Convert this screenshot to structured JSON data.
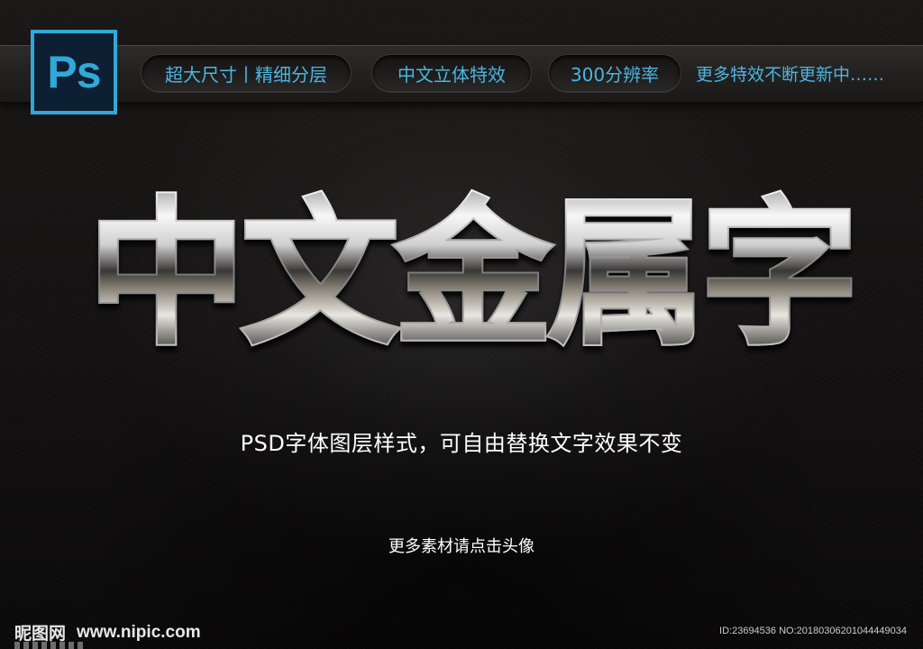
{
  "ps_logo": {
    "text": "Ps",
    "icon": "photoshop-logo-icon",
    "accent_color": "#31a8d8"
  },
  "features": [
    {
      "label": "超大尺寸丨精细分层"
    },
    {
      "label": "中文立体特效"
    },
    {
      "label": "300分辨率"
    }
  ],
  "tagline": "更多特效不断更新中……",
  "headline": "中文金属字",
  "subtitle": "PSD字体图层样式，可自由替换文字效果不变",
  "cta": "更多素材请点击头像",
  "footer": {
    "watermark_cn": "昵图网",
    "watermark_url": "www.nipic.com",
    "image_id": "ID:23694536 NO:20180306201044449034"
  },
  "colors": {
    "accent": "#4cb5e0",
    "background": "#141212",
    "metal_light": "#f2f2f2",
    "metal_dark": "#2a2a2a"
  }
}
